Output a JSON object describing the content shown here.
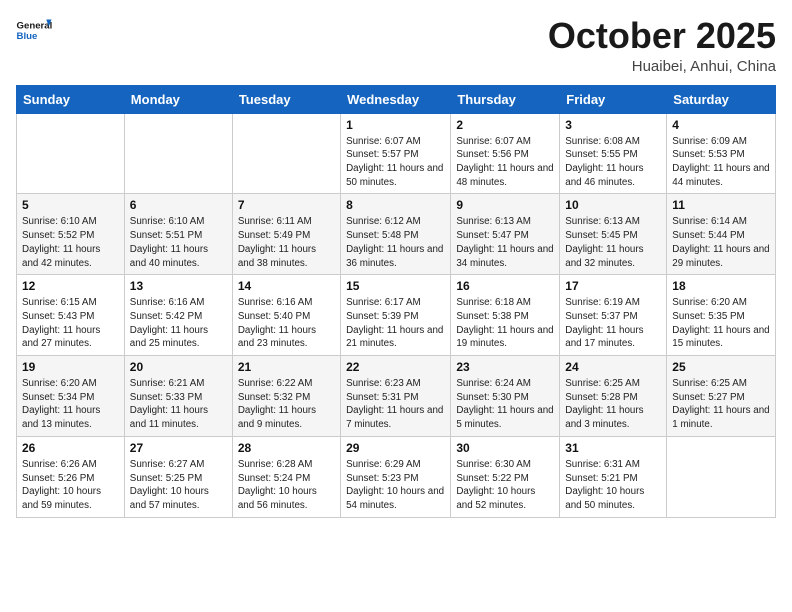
{
  "header": {
    "logo_general": "General",
    "logo_blue": "Blue",
    "month_title": "October 2025",
    "location": "Huaibei, Anhui, China"
  },
  "days_of_week": [
    "Sunday",
    "Monday",
    "Tuesday",
    "Wednesday",
    "Thursday",
    "Friday",
    "Saturday"
  ],
  "weeks": [
    [
      null,
      null,
      null,
      {
        "day": 1,
        "sunrise": "6:07 AM",
        "sunset": "5:57 PM",
        "daylight": "11 hours and 50 minutes."
      },
      {
        "day": 2,
        "sunrise": "6:07 AM",
        "sunset": "5:56 PM",
        "daylight": "11 hours and 48 minutes."
      },
      {
        "day": 3,
        "sunrise": "6:08 AM",
        "sunset": "5:55 PM",
        "daylight": "11 hours and 46 minutes."
      },
      {
        "day": 4,
        "sunrise": "6:09 AM",
        "sunset": "5:53 PM",
        "daylight": "11 hours and 44 minutes."
      }
    ],
    [
      {
        "day": 5,
        "sunrise": "6:10 AM",
        "sunset": "5:52 PM",
        "daylight": "11 hours and 42 minutes."
      },
      {
        "day": 6,
        "sunrise": "6:10 AM",
        "sunset": "5:51 PM",
        "daylight": "11 hours and 40 minutes."
      },
      {
        "day": 7,
        "sunrise": "6:11 AM",
        "sunset": "5:49 PM",
        "daylight": "11 hours and 38 minutes."
      },
      {
        "day": 8,
        "sunrise": "6:12 AM",
        "sunset": "5:48 PM",
        "daylight": "11 hours and 36 minutes."
      },
      {
        "day": 9,
        "sunrise": "6:13 AM",
        "sunset": "5:47 PM",
        "daylight": "11 hours and 34 minutes."
      },
      {
        "day": 10,
        "sunrise": "6:13 AM",
        "sunset": "5:45 PM",
        "daylight": "11 hours and 32 minutes."
      },
      {
        "day": 11,
        "sunrise": "6:14 AM",
        "sunset": "5:44 PM",
        "daylight": "11 hours and 29 minutes."
      }
    ],
    [
      {
        "day": 12,
        "sunrise": "6:15 AM",
        "sunset": "5:43 PM",
        "daylight": "11 hours and 27 minutes."
      },
      {
        "day": 13,
        "sunrise": "6:16 AM",
        "sunset": "5:42 PM",
        "daylight": "11 hours and 25 minutes."
      },
      {
        "day": 14,
        "sunrise": "6:16 AM",
        "sunset": "5:40 PM",
        "daylight": "11 hours and 23 minutes."
      },
      {
        "day": 15,
        "sunrise": "6:17 AM",
        "sunset": "5:39 PM",
        "daylight": "11 hours and 21 minutes."
      },
      {
        "day": 16,
        "sunrise": "6:18 AM",
        "sunset": "5:38 PM",
        "daylight": "11 hours and 19 minutes."
      },
      {
        "day": 17,
        "sunrise": "6:19 AM",
        "sunset": "5:37 PM",
        "daylight": "11 hours and 17 minutes."
      },
      {
        "day": 18,
        "sunrise": "6:20 AM",
        "sunset": "5:35 PM",
        "daylight": "11 hours and 15 minutes."
      }
    ],
    [
      {
        "day": 19,
        "sunrise": "6:20 AM",
        "sunset": "5:34 PM",
        "daylight": "11 hours and 13 minutes."
      },
      {
        "day": 20,
        "sunrise": "6:21 AM",
        "sunset": "5:33 PM",
        "daylight": "11 hours and 11 minutes."
      },
      {
        "day": 21,
        "sunrise": "6:22 AM",
        "sunset": "5:32 PM",
        "daylight": "11 hours and 9 minutes."
      },
      {
        "day": 22,
        "sunrise": "6:23 AM",
        "sunset": "5:31 PM",
        "daylight": "11 hours and 7 minutes."
      },
      {
        "day": 23,
        "sunrise": "6:24 AM",
        "sunset": "5:30 PM",
        "daylight": "11 hours and 5 minutes."
      },
      {
        "day": 24,
        "sunrise": "6:25 AM",
        "sunset": "5:28 PM",
        "daylight": "11 hours and 3 minutes."
      },
      {
        "day": 25,
        "sunrise": "6:25 AM",
        "sunset": "5:27 PM",
        "daylight": "11 hours and 1 minute."
      }
    ],
    [
      {
        "day": 26,
        "sunrise": "6:26 AM",
        "sunset": "5:26 PM",
        "daylight": "10 hours and 59 minutes."
      },
      {
        "day": 27,
        "sunrise": "6:27 AM",
        "sunset": "5:25 PM",
        "daylight": "10 hours and 57 minutes."
      },
      {
        "day": 28,
        "sunrise": "6:28 AM",
        "sunset": "5:24 PM",
        "daylight": "10 hours and 56 minutes."
      },
      {
        "day": 29,
        "sunrise": "6:29 AM",
        "sunset": "5:23 PM",
        "daylight": "10 hours and 54 minutes."
      },
      {
        "day": 30,
        "sunrise": "6:30 AM",
        "sunset": "5:22 PM",
        "daylight": "10 hours and 52 minutes."
      },
      {
        "day": 31,
        "sunrise": "6:31 AM",
        "sunset": "5:21 PM",
        "daylight": "10 hours and 50 minutes."
      },
      null
    ]
  ]
}
